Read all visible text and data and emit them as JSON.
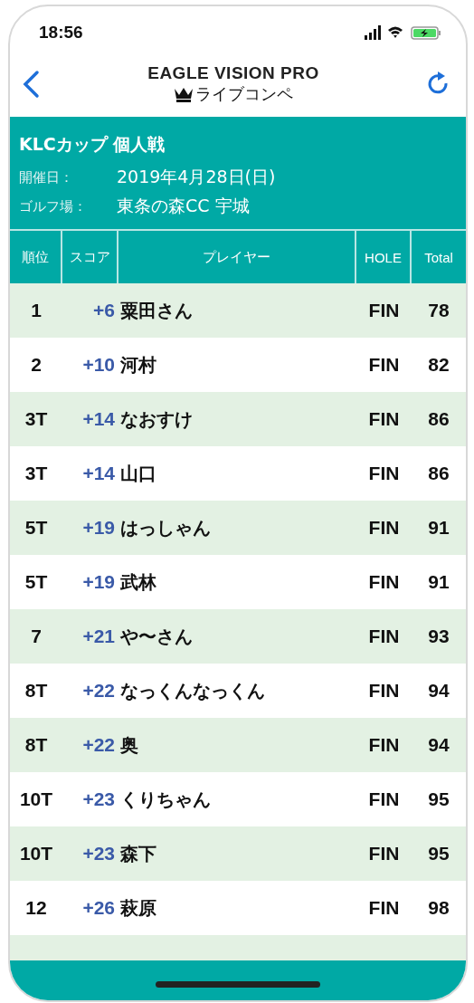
{
  "status_bar": {
    "time": "18:56"
  },
  "header": {
    "title": "EAGLE VISION PRO",
    "subtitle": "ライブコンペ"
  },
  "event": {
    "name": "KLCカップ 個人戦",
    "fields": [
      {
        "label": "開催日：",
        "value": "2019年4月28日(日)"
      },
      {
        "label": "ゴルフ場：",
        "value": "東条の森CC 宇城"
      }
    ]
  },
  "table": {
    "columns": [
      "順位",
      "スコア",
      "プレイヤー",
      "HOLE",
      "Total"
    ],
    "rows": [
      {
        "rank": "1",
        "score": "+6",
        "player": "粟田さん",
        "hole": "FIN",
        "total": "78"
      },
      {
        "rank": "2",
        "score": "+10",
        "player": "河村",
        "hole": "FIN",
        "total": "82"
      },
      {
        "rank": "3T",
        "score": "+14",
        "player": "なおすけ",
        "hole": "FIN",
        "total": "86"
      },
      {
        "rank": "3T",
        "score": "+14",
        "player": "山口",
        "hole": "FIN",
        "total": "86"
      },
      {
        "rank": "5T",
        "score": "+19",
        "player": "はっしゃん",
        "hole": "FIN",
        "total": "91"
      },
      {
        "rank": "5T",
        "score": "+19",
        "player": "武林",
        "hole": "FIN",
        "total": "91"
      },
      {
        "rank": "7",
        "score": "+21",
        "player": "や〜さん",
        "hole": "FIN",
        "total": "93"
      },
      {
        "rank": "8T",
        "score": "+22",
        "player": "なっくんなっくん",
        "hole": "FIN",
        "total": "94"
      },
      {
        "rank": "8T",
        "score": "+22",
        "player": "奥",
        "hole": "FIN",
        "total": "94"
      },
      {
        "rank": "10T",
        "score": "+23",
        "player": "くりちゃん",
        "hole": "FIN",
        "total": "95"
      },
      {
        "rank": "10T",
        "score": "+23",
        "player": "森下",
        "hole": "FIN",
        "total": "95"
      },
      {
        "rank": "12",
        "score": "+26",
        "player": "萩原",
        "hole": "FIN",
        "total": "98"
      }
    ]
  }
}
